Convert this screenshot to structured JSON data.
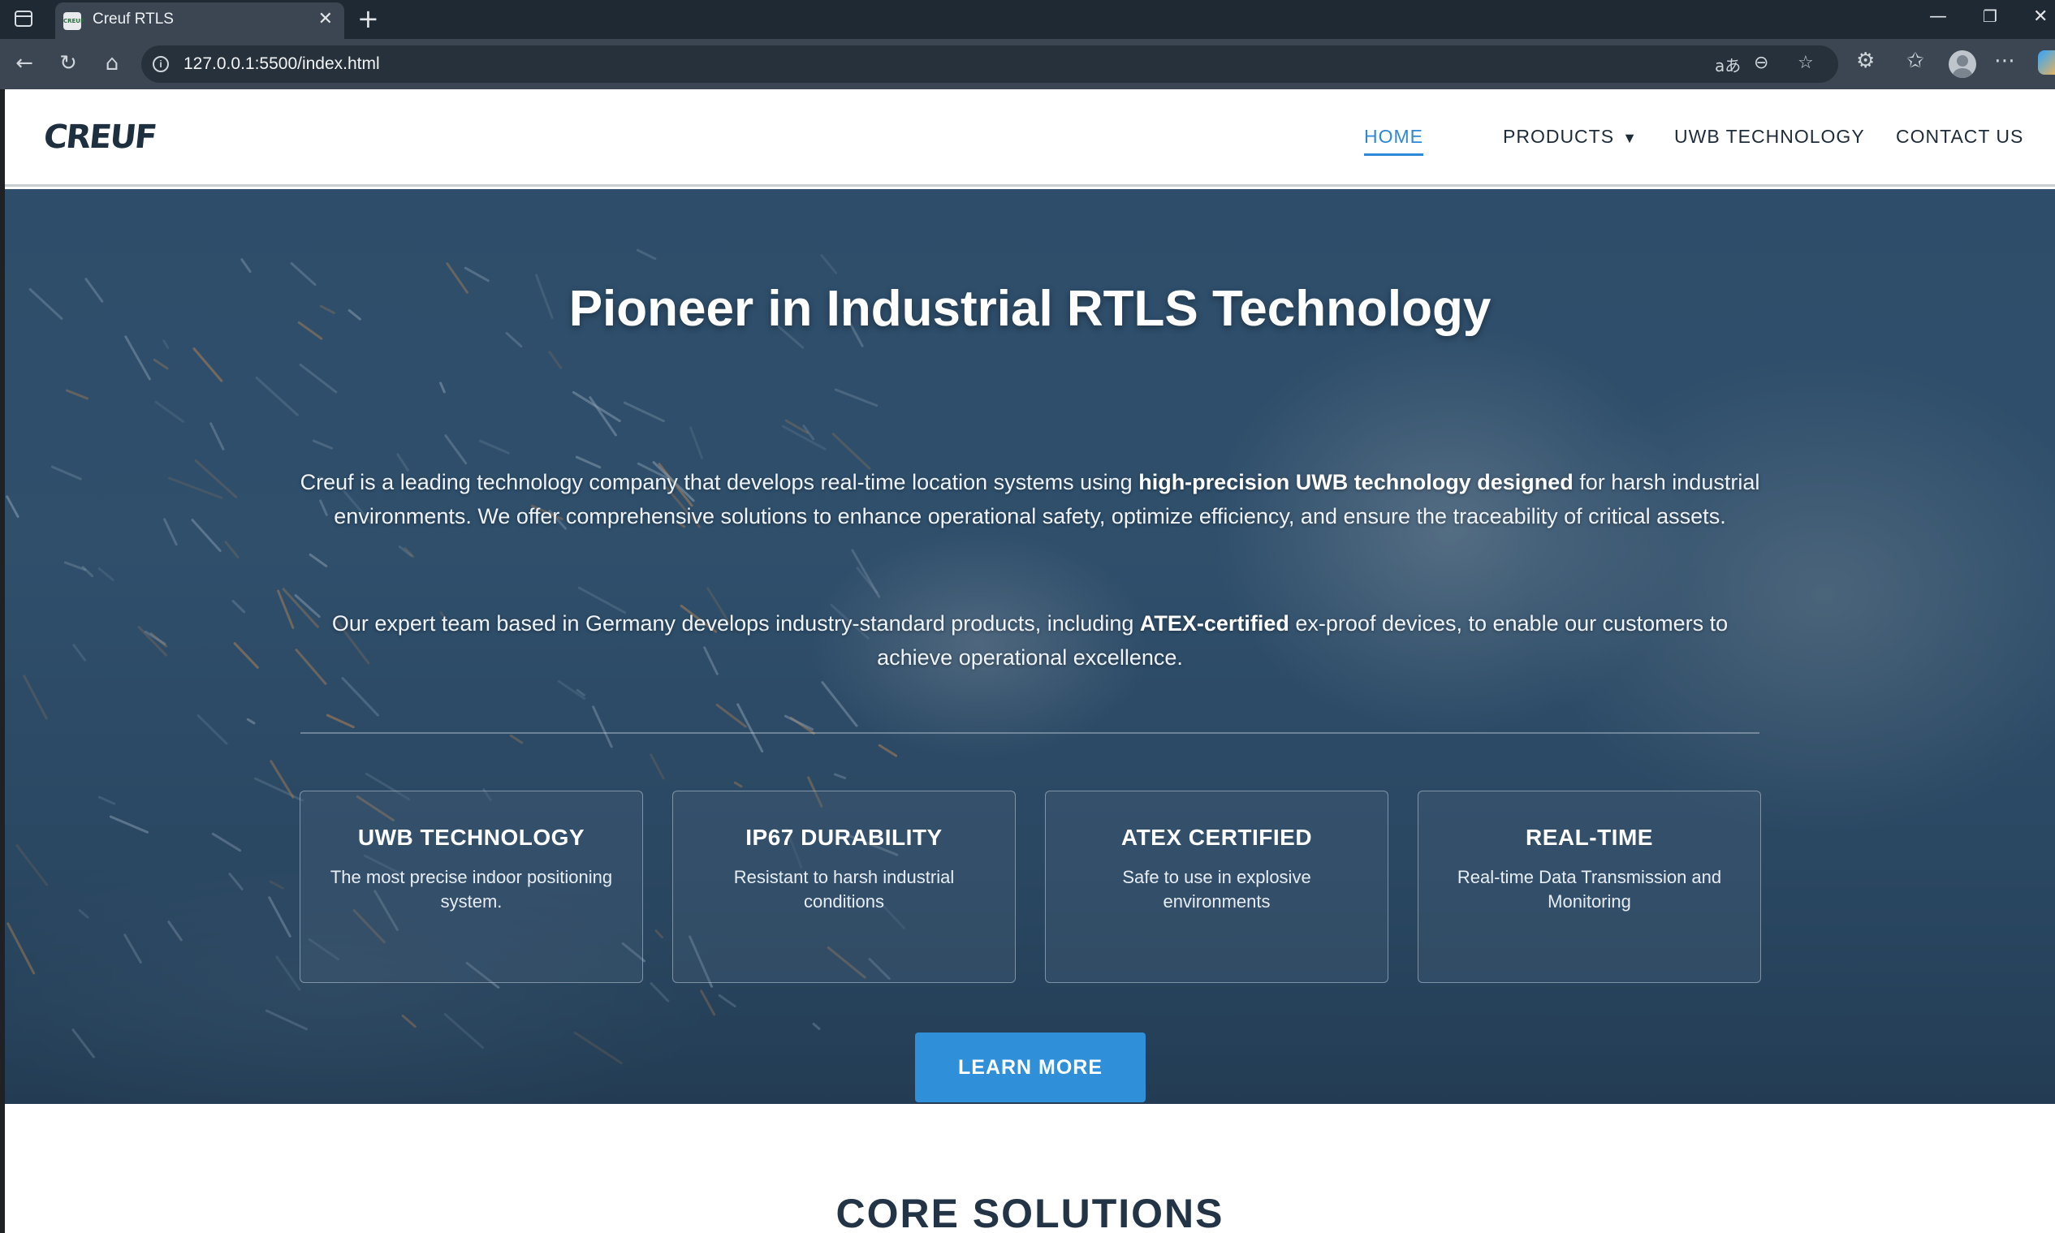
{
  "browser": {
    "tab_title": "Creuf RTLS",
    "favicon_text": "CREUF",
    "url": "127.0.0.1:5500/index.html",
    "icons": [
      "sidebar-icon",
      "close-icon",
      "new-tab-icon",
      "minimize-icon",
      "restore-icon",
      "back-icon",
      "reload-icon",
      "home-icon",
      "info-icon",
      "read-aloud-icon",
      "reader-icon",
      "favorite-icon",
      "extensions-icon",
      "favorites-icon",
      "profile-icon",
      "more-icon",
      "copilot-icon"
    ]
  },
  "header": {
    "logo": "CREUF",
    "nav": {
      "home": "HOME",
      "products": "PRODUCTS",
      "uwb": "UWB TECHNOLOGY",
      "contact": "CONTACT US"
    }
  },
  "hero": {
    "title": "Pioneer in Industrial RTLS Technology",
    "p1_a": "Creuf is a leading technology company that develops real-time location systems using ",
    "p1_b": "high-precision UWB technology designed",
    "p1_c": " for harsh industrial environments. We offer comprehensive solutions to enhance operational safety, optimize efficiency, and ensure the traceability of critical assets.",
    "p2_a": "Our expert team based in Germany develops industry-standard products, including ",
    "p2_b": "ATEX-certified",
    "p2_c": " ex-proof devices, to enable our customers to achieve operational excellence.",
    "features": [
      {
        "title": "UWB TECHNOLOGY",
        "text": "The most precise indoor positioning system."
      },
      {
        "title": "IP67 DURABILITY",
        "text": "Resistant to harsh industrial conditions"
      },
      {
        "title": "ATEX CERTIFIED",
        "text": "Safe to use in explosive environments"
      },
      {
        "title": "REAL-TIME",
        "text": "Real-time Data Transmission and Monitoring"
      }
    ],
    "cta": "LEARN MORE"
  },
  "sections": {
    "core_title": "CORE SOLUTIONS"
  },
  "colors": {
    "accent": "#2f8fd9",
    "nav_active": "#2d88d8",
    "heading_dark": "#233446"
  }
}
